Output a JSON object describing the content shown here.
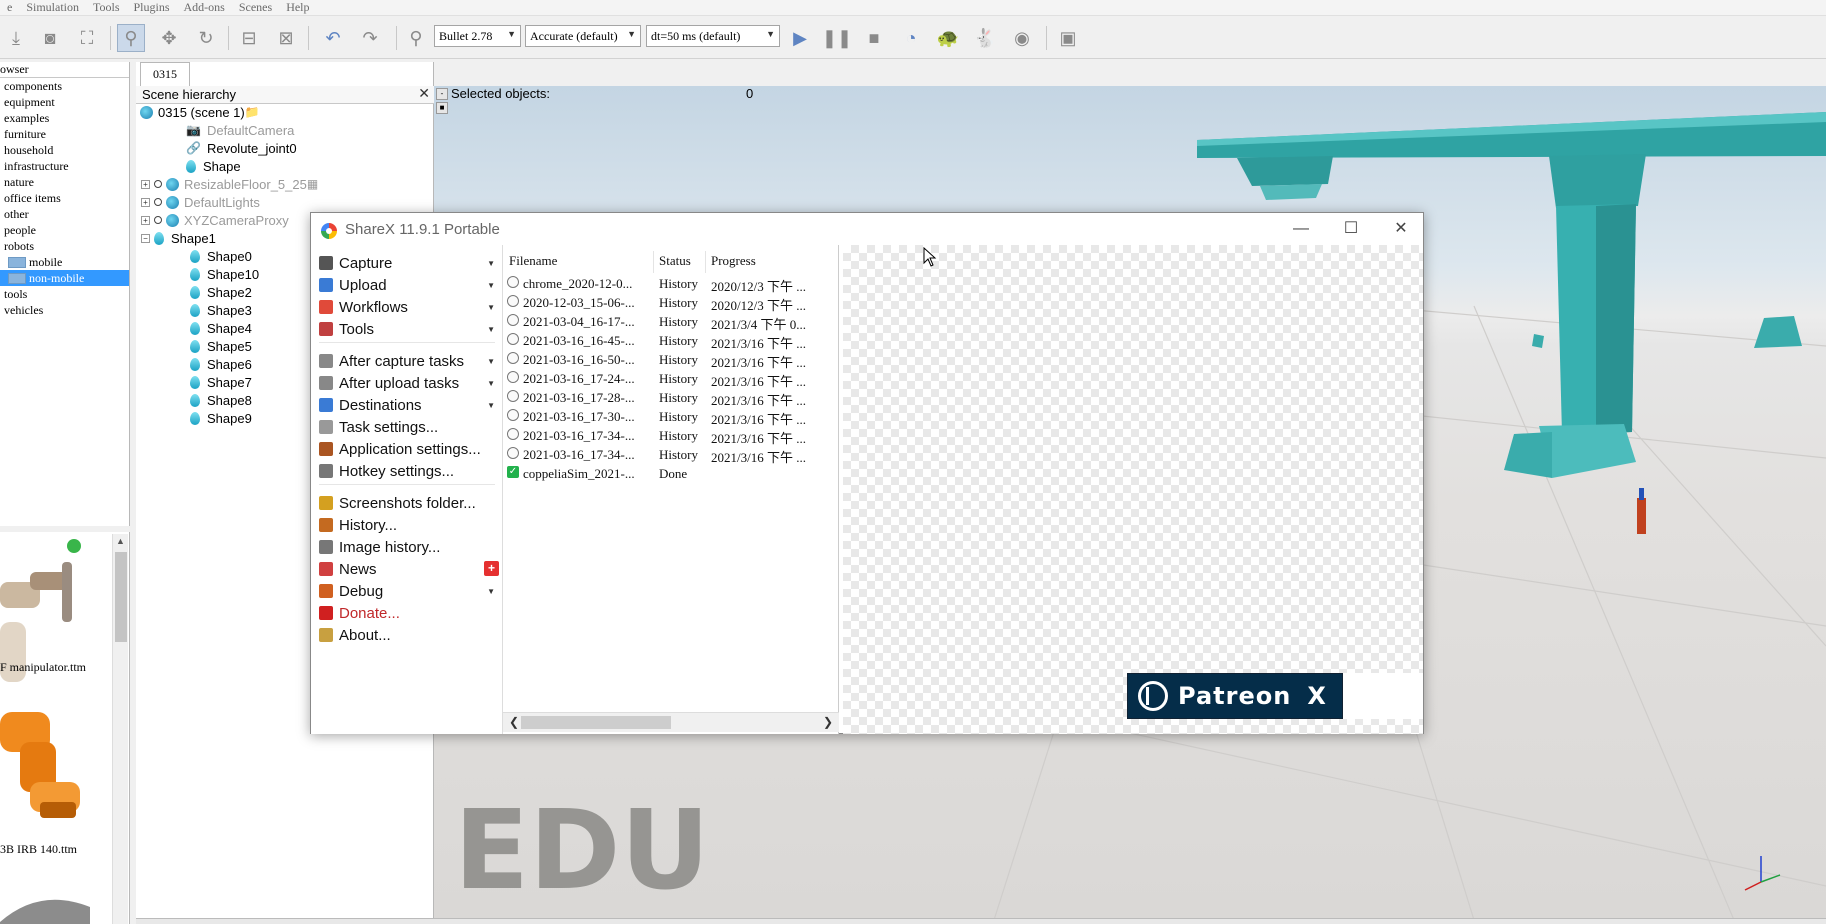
{
  "menubar": {
    "items": [
      "e",
      "Simulation",
      "Tools",
      "Plugins",
      "Add-ons",
      "Scenes",
      "Help"
    ]
  },
  "toolbar": {
    "engine": "Bullet 2.78",
    "accuracy": "Accurate (default)",
    "timestep": "dt=50 ms (default)",
    "icons": [
      "import-icon",
      "camera-icon",
      "fit-view-icon",
      "select-icon",
      "move-icon",
      "rotate-icon",
      "assemble-icon",
      "disassemble-icon",
      "undo-icon",
      "redo-icon",
      "search-icon",
      "play-icon",
      "pause-icon",
      "stop-icon",
      "realtime-icon",
      "slower-icon",
      "faster-icon",
      "visualization-icon",
      "page-icon"
    ]
  },
  "browser": {
    "header": "owser",
    "items": [
      {
        "label": "components",
        "level": 0,
        "selected": false
      },
      {
        "label": "equipment",
        "level": 0,
        "selected": false
      },
      {
        "label": "examples",
        "level": 0,
        "selected": false
      },
      {
        "label": "furniture",
        "level": 0,
        "selected": false
      },
      {
        "label": "household",
        "level": 0,
        "selected": false
      },
      {
        "label": "infrastructure",
        "level": 0,
        "selected": false
      },
      {
        "label": "nature",
        "level": 0,
        "selected": false
      },
      {
        "label": "office items",
        "level": 0,
        "selected": false
      },
      {
        "label": "other",
        "level": 0,
        "selected": false
      },
      {
        "label": "people",
        "level": 0,
        "selected": false
      },
      {
        "label": "robots",
        "level": 0,
        "selected": false
      },
      {
        "label": "mobile",
        "level": 1,
        "selected": false
      },
      {
        "label": "non-mobile",
        "level": 1,
        "selected": true
      },
      {
        "label": "tools",
        "level": 0,
        "selected": false
      },
      {
        "label": "vehicles",
        "level": 0,
        "selected": false
      }
    ],
    "thumbnails": [
      "F manipulator.ttm",
      "3B IRB 140.ttm"
    ]
  },
  "scene": {
    "tab": "0315",
    "hierarchy_title": "Scene hierarchy",
    "root": "0315 (scene 1)",
    "nodes": [
      {
        "label": "DefaultCamera",
        "grey": true
      },
      {
        "label": "Revolute_joint0",
        "grey": false
      },
      {
        "label": "Shape",
        "grey": false
      },
      {
        "label": "ResizableFloor_5_25",
        "grey": true
      },
      {
        "label": "DefaultLights",
        "grey": true
      },
      {
        "label": "XYZCameraProxy",
        "grey": true
      },
      {
        "label": "Shape1",
        "grey": false
      }
    ],
    "children": [
      "Shape0",
      "Shape10",
      "Shape2",
      "Shape3",
      "Shape4",
      "Shape5",
      "Shape6",
      "Shape7",
      "Shape8",
      "Shape9"
    ]
  },
  "viewport": {
    "selected_label": "Selected objects:",
    "selected_count": "0",
    "watermark": "EDU"
  },
  "sharex": {
    "title": "ShareX 11.9.1 Portable",
    "menu": [
      {
        "label": "Capture",
        "dropdown": true
      },
      {
        "label": "Upload",
        "dropdown": true
      },
      {
        "label": "Workflows",
        "dropdown": true
      },
      {
        "label": "Tools",
        "dropdown": true
      },
      {
        "label": "After capture tasks",
        "dropdown": true
      },
      {
        "label": "After upload tasks",
        "dropdown": true
      },
      {
        "label": "Destinations",
        "dropdown": true
      },
      {
        "label": "Task settings...",
        "dropdown": false
      },
      {
        "label": "Application settings...",
        "dropdown": false
      },
      {
        "label": "Hotkey settings...",
        "dropdown": false
      },
      {
        "label": "Screenshots folder...",
        "dropdown": false
      },
      {
        "label": "History...",
        "dropdown": false
      },
      {
        "label": "Image history...",
        "dropdown": false
      },
      {
        "label": "News",
        "dropdown": false
      },
      {
        "label": "Debug",
        "dropdown": true
      },
      {
        "label": "Donate...",
        "dropdown": false
      },
      {
        "label": "About...",
        "dropdown": false
      }
    ],
    "news_badge": "+",
    "columns": [
      "Filename",
      "Status",
      "Progress"
    ],
    "rows": [
      {
        "filename": "chrome_2020-12-0...",
        "status": "History",
        "progress": "2020/12/3 下午 ..."
      },
      {
        "filename": "2020-12-03_15-06-...",
        "status": "History",
        "progress": "2020/12/3 下午 ..."
      },
      {
        "filename": "2021-03-04_16-17-...",
        "status": "History",
        "progress": "2021/3/4 下午 0..."
      },
      {
        "filename": "2021-03-16_16-45-...",
        "status": "History",
        "progress": "2021/3/16 下午 ..."
      },
      {
        "filename": "2021-03-16_16-50-...",
        "status": "History",
        "progress": "2021/3/16 下午 ..."
      },
      {
        "filename": "2021-03-16_17-24-...",
        "status": "History",
        "progress": "2021/3/16 下午 ..."
      },
      {
        "filename": "2021-03-16_17-28-...",
        "status": "History",
        "progress": "2021/3/16 下午 ..."
      },
      {
        "filename": "2021-03-16_17-30-...",
        "status": "History",
        "progress": "2021/3/16 下午 ..."
      },
      {
        "filename": "2021-03-16_17-34-...",
        "status": "History",
        "progress": "2021/3/16 下午 ..."
      },
      {
        "filename": "2021-03-16_17-34-...",
        "status": "History",
        "progress": "2021/3/16 下午 ..."
      },
      {
        "filename": "coppeliaSim_2021-...",
        "status": "Done",
        "progress": ""
      }
    ],
    "patreon_label": "Patreon",
    "patreon_close": "X",
    "colors": {
      "donate": "#c0282a",
      "patreon_bg": "#052d49",
      "selection": "#3399ff"
    }
  }
}
